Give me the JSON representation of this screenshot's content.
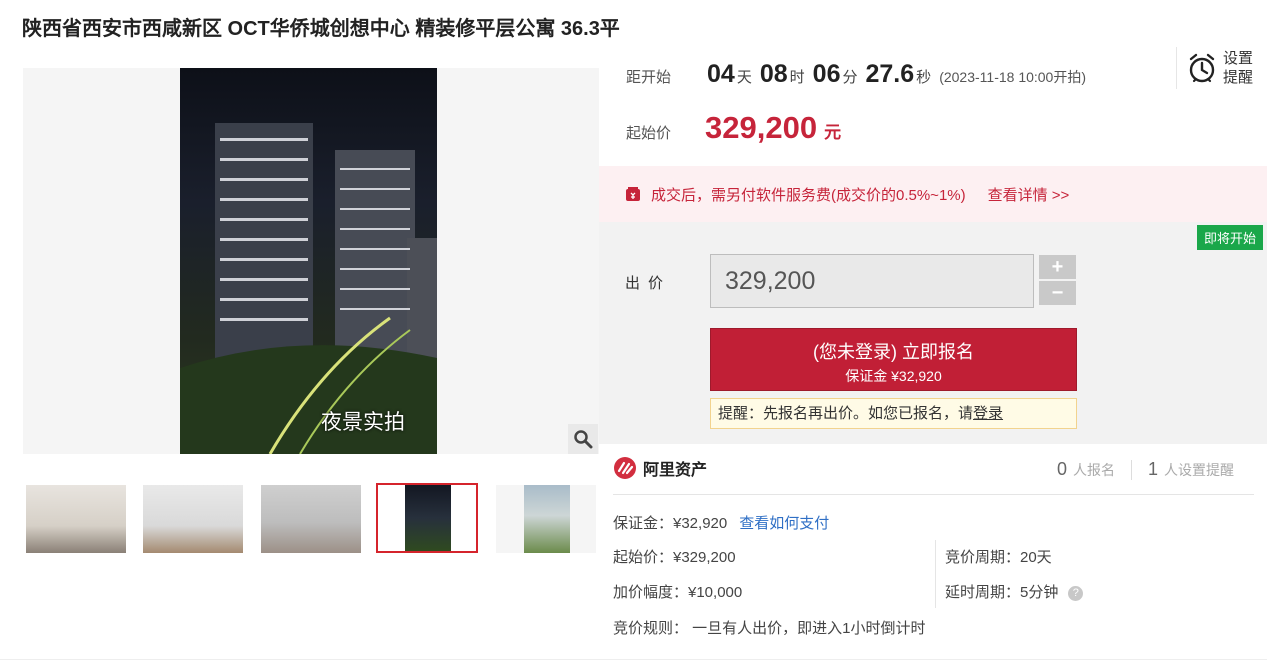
{
  "title": "陕西省西安市西咸新区 OCT华侨城创想中心 精装修平层公寓 36.3平",
  "gallery": {
    "caption": "夜景实拍"
  },
  "countdown": {
    "label": "距开始",
    "days": "04",
    "days_unit": "天",
    "hours": "08",
    "hours_unit": "时",
    "minutes": "06",
    "minutes_unit": "分",
    "seconds": "27.6",
    "seconds_unit": "秒",
    "start_time": "(2023-11-18 10:00开拍)"
  },
  "reminder": {
    "label": "设置提醒"
  },
  "start_price": {
    "label": "起始价",
    "value": "329,200",
    "unit": "元"
  },
  "notice": {
    "text": "成交后，需另付软件服务费(成交价的0.5%~1%)",
    "link": "查看详情 >>"
  },
  "bid": {
    "status_badge": "即将开始",
    "label": "出价",
    "input_value": "329,200",
    "plus": "+",
    "minus": "−",
    "signup_line1": "(您未登录) 立即报名",
    "signup_line2": "保证金 ¥32,920",
    "tip_text": "提醒：先报名再出价。如您已报名，请",
    "tip_link": "登录"
  },
  "provider": {
    "name": "阿里资产"
  },
  "stats": {
    "signups": "0",
    "signups_label": "人报名",
    "reminders": "1",
    "reminders_label": "人设置提醒"
  },
  "details": {
    "deposit": "保证金：¥32,920",
    "deposit_link": "查看如何支付",
    "start_price": "起始价：¥329,200",
    "increment": "加价幅度：¥10,000",
    "rule": "竞价规则：  一旦有人出价，即进入1小时倒计时",
    "cycle": "竞价周期：20天",
    "delay": "延时周期：5分钟"
  },
  "colors": {
    "accent": "#c11f36",
    "badge": "#1aa74a",
    "link": "#2f6fc5"
  }
}
